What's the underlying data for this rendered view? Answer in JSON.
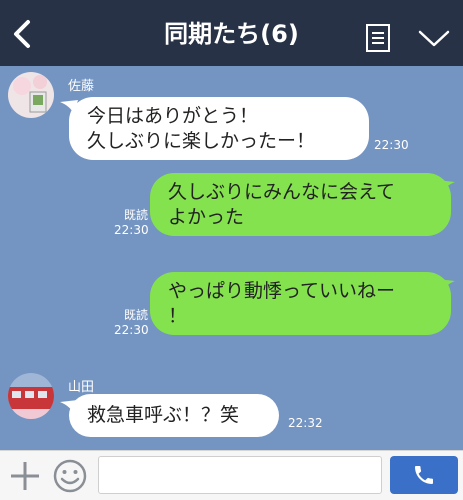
{
  "header": {
    "title": "同期たち(6)"
  },
  "messages": [
    {
      "sender": "佐藤",
      "lines": [
        "今日はありがとう！",
        "久しぶりに楽しかったー！"
      ],
      "time": "22:30"
    },
    {
      "read": "既読",
      "lines": [
        "久しぶりにみんなに会えて",
        "よかった"
      ],
      "time": "22:30"
    },
    {
      "read": "既読",
      "lines": [
        "やっぱり動悸っていいねー",
        "！"
      ],
      "time": "22:30"
    },
    {
      "sender": "山田",
      "lines": [
        "救急車呼ぶ！？笑"
      ],
      "time": "22:32"
    }
  ],
  "footer": {
    "input_value": "",
    "input_placeholder": ""
  },
  "colors": {
    "header_bg": "#273246",
    "chat_bg": "#7494c1",
    "incoming_bubble": "#ffffff",
    "outgoing_bubble": "#84e24e",
    "call_button": "#3a70c8"
  }
}
